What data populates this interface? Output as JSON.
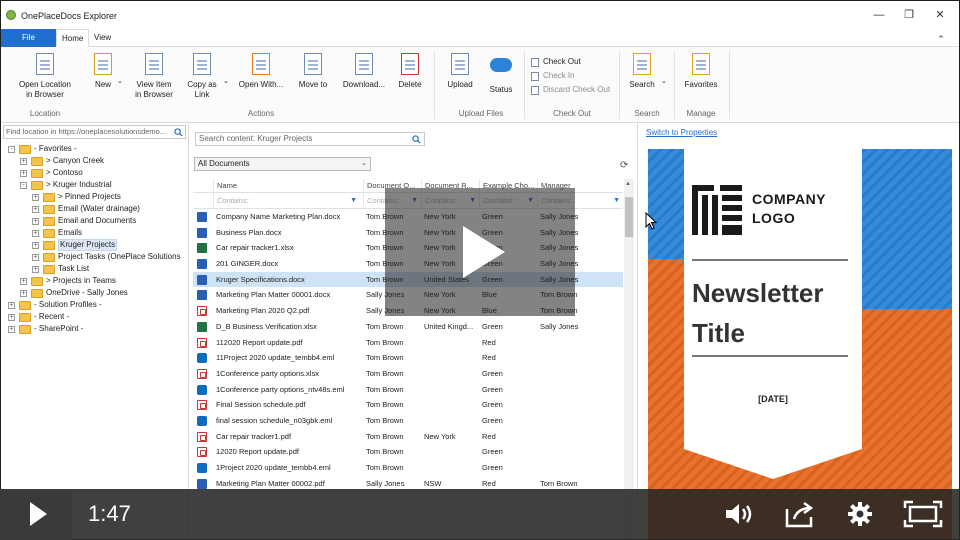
{
  "window": {
    "title": "OnePlaceDocs Explorer",
    "minimize": "—",
    "restore": "❐",
    "close": "✕",
    "collapse": "⌃"
  },
  "tabs": {
    "file": "File",
    "home": "Home",
    "view": "View"
  },
  "ribbon": {
    "buttons": [
      {
        "label": "Open Location\nin Browser",
        "icon": "open-location-icon"
      },
      {
        "label": "New",
        "icon": "new-icon"
      },
      {
        "label": "View Item\nin Browser",
        "icon": "view-item-icon"
      },
      {
        "label": "Copy as\nLink",
        "icon": "copy-link-icon"
      },
      {
        "label": "Open With...",
        "icon": "open-with-icon"
      },
      {
        "label": "Move to",
        "icon": "move-to-icon"
      },
      {
        "label": "Download...",
        "icon": "download-icon"
      },
      {
        "label": "Delete",
        "icon": "delete-icon"
      },
      {
        "label": "Upload",
        "icon": "upload-icon"
      },
      {
        "label": "Status",
        "icon": "status-icon"
      },
      {
        "label": "Search",
        "icon": "search-icon"
      },
      {
        "label": "Favorites",
        "icon": "favorites-icon"
      }
    ],
    "checkout": {
      "check_out": "Check Out",
      "check_in": "Check In",
      "discard": "Discard Check Out"
    },
    "groups": {
      "location": "Location",
      "actions": "Actions",
      "upload_files": "Upload Files",
      "check_out": "Check Out",
      "search": "Search",
      "manage": "Manage"
    }
  },
  "left": {
    "find_placeholder": "Find location in https://oneplacesolutionsdemo...",
    "tree": [
      {
        "label": "- Favorites -",
        "level": 0,
        "expander": "-"
      },
      {
        "label": "> Canyon Creek",
        "level": 1,
        "expander": "+"
      },
      {
        "label": "> Contoso",
        "level": 1,
        "expander": "+"
      },
      {
        "label": "> Kruger Industrial",
        "level": 1,
        "expander": "-"
      },
      {
        "label": "> Pinned Projects",
        "level": 2,
        "expander": "+"
      },
      {
        "label": "Email (Water drainage)",
        "level": 2,
        "expander": "+"
      },
      {
        "label": "Email and Documents",
        "level": 2,
        "expander": "+"
      },
      {
        "label": "Emails",
        "level": 2,
        "expander": "+"
      },
      {
        "label": "Kruger Projects",
        "level": 2,
        "expander": "+",
        "selected": true
      },
      {
        "label": "Project Tasks (OnePlace Solutions",
        "level": 2,
        "expander": "+"
      },
      {
        "label": "Task List",
        "level": 2,
        "expander": "+"
      },
      {
        "label": "> Projects in Teams",
        "level": 1,
        "expander": "+"
      },
      {
        "label": "OneDrive - Sally Jones",
        "level": 1,
        "expander": "+"
      },
      {
        "label": "- Solution Profiles -",
        "level": 0,
        "expander": "+"
      },
      {
        "label": "- Recent -",
        "level": 0,
        "expander": "+"
      },
      {
        "label": "- SharePoint -",
        "level": 0,
        "expander": "+"
      }
    ]
  },
  "middle": {
    "search_placeholder": "Search content: Kruger Projects",
    "view": "All Documents",
    "refresh": "⟳",
    "columns": [
      "Name",
      "Document O...",
      "Document R...",
      "Example Cho...",
      "Manager"
    ],
    "filter_placeholder": "Contains:",
    "rows": [
      {
        "type": "docx",
        "name": "Company Name Marketing Plan.docx",
        "owner": "Tom Brown",
        "region": "New York",
        "choice": "Green",
        "manager": "Sally Jones"
      },
      {
        "type": "docx",
        "name": "Business Plan.docx",
        "owner": "Tom Brown",
        "region": "New York",
        "choice": "Green",
        "manager": "Sally Jones"
      },
      {
        "type": "xlsx",
        "name": "Car repair tracker1.xlsx",
        "owner": "Tom Brown",
        "region": "New York",
        "choice": "Green",
        "manager": "Sally Jones"
      },
      {
        "type": "docx",
        "name": "201 GINGER.docx",
        "owner": "Tom Brown",
        "region": "New York",
        "choice": "Green",
        "manager": "Sally Jones"
      },
      {
        "type": "docx",
        "name": "Kruger Specifications.docx",
        "owner": "Tom Brown",
        "region": "United States",
        "choice": "Green",
        "manager": "Sally Jones",
        "selected": true
      },
      {
        "type": "docx",
        "name": "Marketing Plan Matter 00001.docx",
        "owner": "Sally Jones",
        "region": "New York",
        "choice": "Blue",
        "manager": "Tom Brown"
      },
      {
        "type": "pdf",
        "name": "Marketing Plan 2020 Q2.pdf",
        "owner": "Sally Jones",
        "region": "New York",
        "choice": "Blue",
        "manager": "Tom Brown"
      },
      {
        "type": "xlsx",
        "name": "D_B Business Verification.xlsx",
        "owner": "Tom Brown",
        "region": "United Kingd...",
        "choice": "Green",
        "manager": "Sally Jones"
      },
      {
        "type": "pdf",
        "name": "112020 Report update.pdf",
        "owner": "Tom Brown",
        "region": "",
        "choice": "Red",
        "manager": ""
      },
      {
        "type": "eml",
        "name": "11Project 2020 update_tembb4.eml",
        "owner": "Tom Brown",
        "region": "",
        "choice": "Red",
        "manager": ""
      },
      {
        "type": "pdf",
        "name": "1Conference party options.xlsx",
        "owner": "Tom Brown",
        "region": "",
        "choice": "Green",
        "manager": ""
      },
      {
        "type": "eml",
        "name": "1Conference party options_ntv48s.eml",
        "owner": "Tom Brown",
        "region": "",
        "choice": "Green",
        "manager": ""
      },
      {
        "type": "pdf",
        "name": "Final Session schedule.pdf",
        "owner": "Tom Brown",
        "region": "",
        "choice": "Green",
        "manager": ""
      },
      {
        "type": "eml",
        "name": "final session schedule_n03gbk.eml",
        "owner": "Tom Brown",
        "region": "",
        "choice": "Green",
        "manager": ""
      },
      {
        "type": "pdf",
        "name": "Car repair tracker1.pdf",
        "owner": "Tom Brown",
        "region": "New York",
        "choice": "Red",
        "manager": ""
      },
      {
        "type": "pdf",
        "name": "12020 Report update.pdf",
        "owner": "Tom Brown",
        "region": "",
        "choice": "Green",
        "manager": ""
      },
      {
        "type": "eml",
        "name": "1Project 2020 update_tembb4.eml",
        "owner": "Tom Brown",
        "region": "",
        "choice": "Green",
        "manager": ""
      },
      {
        "type": "docx",
        "name": "Marketing Plan Matter 00002.pdf",
        "owner": "Sally Jones",
        "region": "NSW",
        "choice": "Red",
        "manager": "Tom Brown"
      }
    ]
  },
  "right": {
    "switch_link": "Switch to Properties",
    "preview": {
      "logo_line1": "COMPANY",
      "logo_line2": "LOGO",
      "title_line1": "Newsletter",
      "title_line2": "Title",
      "date": "[DATE]"
    }
  },
  "video": {
    "time": "1:47",
    "icons": [
      "play-icon",
      "volume-icon",
      "share-icon",
      "settings-icon",
      "fullscreen-icon"
    ]
  },
  "colors": {
    "accent": "#1f6fd1",
    "selection": "#cfe3f7",
    "banner_orange": "#e76a21",
    "sky_blue": "#2b84d8"
  }
}
